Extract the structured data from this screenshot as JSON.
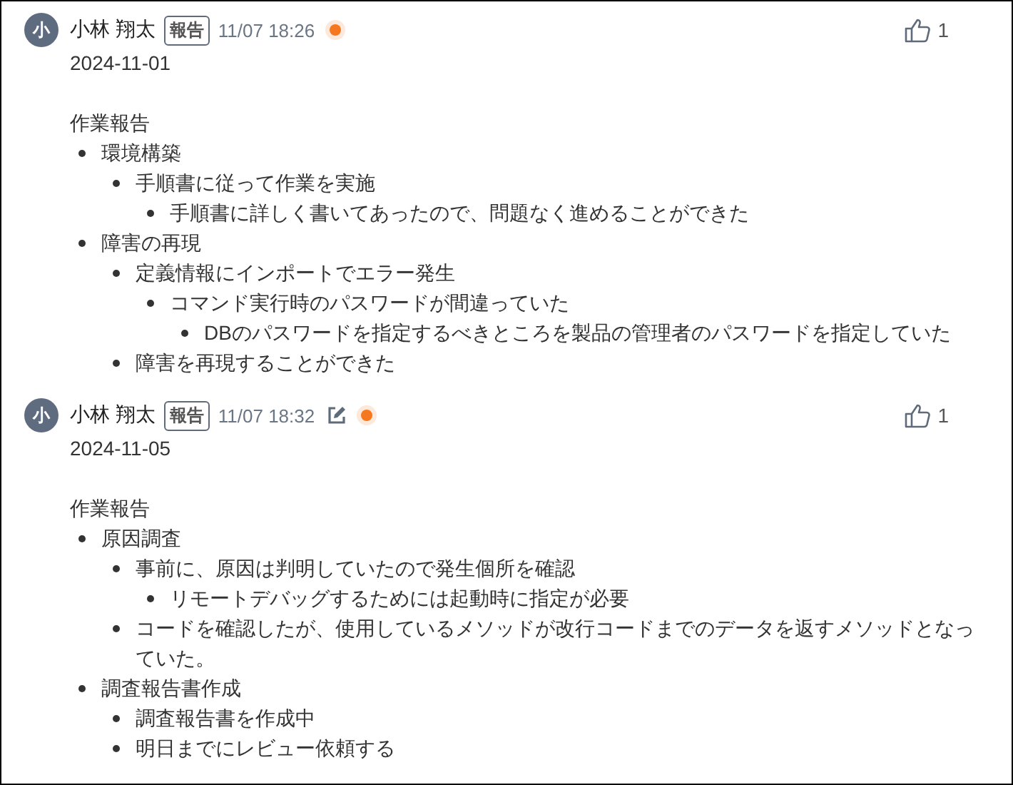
{
  "posts": [
    {
      "author": "小林 翔太",
      "avatar": "小",
      "tag": "報告",
      "time": "11/07 18:26",
      "edited": false,
      "unread": true,
      "likes": "1",
      "date": "2024-11-01",
      "heading": "作業報告",
      "items": [
        {
          "text": "環境構築",
          "children": [
            {
              "text": "手順書に従って作業を実施",
              "children": [
                {
                  "text": "手順書に詳しく書いてあったので、問題なく進めることができた"
                }
              ]
            }
          ]
        },
        {
          "text": "障害の再現",
          "children": [
            {
              "text": "定義情報にインポートでエラー発生",
              "children": [
                {
                  "text": "コマンド実行時のパスワードが間違っていた",
                  "children": [
                    {
                      "text": "DBのパスワードを指定するべきところを製品の管理者のパスワードを指定していた"
                    }
                  ]
                }
              ]
            },
            {
              "text": "障害を再現することができた"
            }
          ]
        }
      ]
    },
    {
      "author": "小林 翔太",
      "avatar": "小",
      "tag": "報告",
      "time": "11/07 18:32",
      "edited": true,
      "unread": true,
      "likes": "1",
      "date": "2024-11-05",
      "heading": "作業報告",
      "items": [
        {
          "text": "原因調査",
          "children": [
            {
              "text": "事前に、原因は判明していたので発生個所を確認",
              "children": [
                {
                  "text": "リモートデバッグするためには起動時に指定が必要"
                }
              ]
            },
            {
              "text": "コードを確認したが、使用しているメソッドが改行コードまでのデータを返すメソッドとなっていた。"
            }
          ]
        },
        {
          "text": "調査報告書作成",
          "children": [
            {
              "text": "調査報告書を作成中"
            },
            {
              "text": "明日までにレビュー依頼する"
            }
          ]
        }
      ]
    }
  ]
}
